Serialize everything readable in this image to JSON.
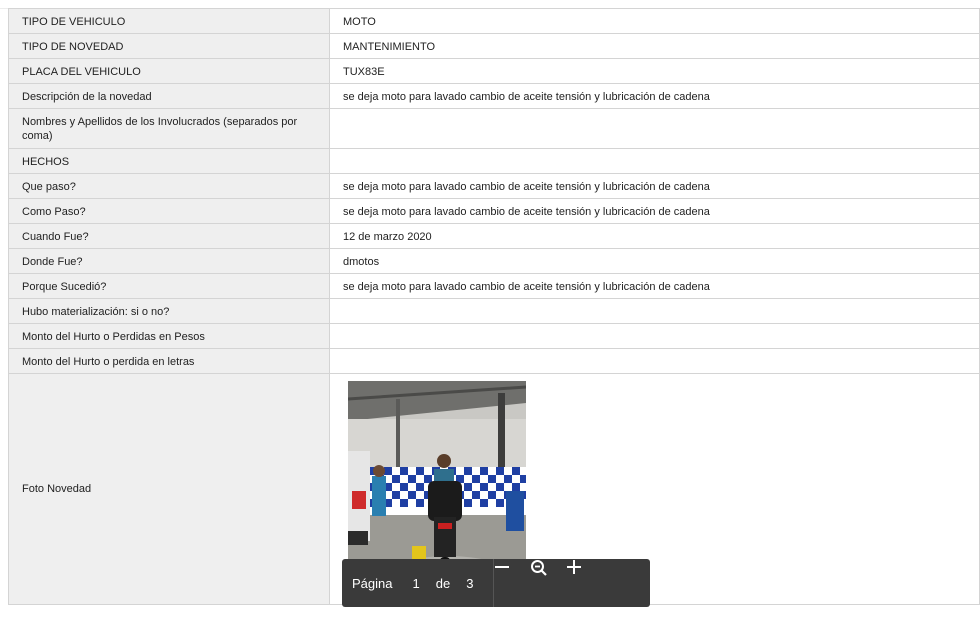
{
  "rows": [
    {
      "label": "TIPO DE VEHICULO",
      "value": "MOTO"
    },
    {
      "label": "TIPO DE NOVEDAD",
      "value": "MANTENIMIENTO"
    },
    {
      "label": "PLACA DEL VEHICULO",
      "value": "TUX83E"
    },
    {
      "label": "Descripción de la novedad",
      "value": "se deja moto para lavado cambio de aceite tensión y lubricación de cadena"
    },
    {
      "label": "Nombres y Apellidos de los Involucrados (separados por coma)",
      "value": ""
    },
    {
      "label": "HECHOS",
      "value": ""
    },
    {
      "label": "Que paso?",
      "value": "se deja moto para lavado cambio de aceite tensión y lubricación de cadena"
    },
    {
      "label": "Como Paso?",
      "value": "se deja moto para lavado cambio de aceite tensión y lubricación de cadena"
    },
    {
      "label": "Cuando Fue?",
      "value": "12 de marzo 2020"
    },
    {
      "label": "Donde Fue?",
      "value": "dmotos"
    },
    {
      "label": "Porque Sucedió?",
      "value": "se deja moto para lavado cambio de aceite tensión y lubricación de cadena"
    },
    {
      "label": "Hubo materialización: si o no?",
      "value": ""
    },
    {
      "label": "Monto del Hurto o Perdidas en Pesos",
      "value": ""
    },
    {
      "label": "Monto del Hurto o perdida en letras",
      "value": ""
    },
    {
      "label": "Foto Novedad",
      "value": ""
    }
  ],
  "pager": {
    "label": "Página",
    "current": "1",
    "of": "de",
    "total": "3",
    "icons": [
      "minus-icon",
      "zoom-out-icon",
      "plus-icon"
    ]
  },
  "colors": {
    "label_bg": "#efefef",
    "border": "#d4d4d4",
    "pager_bg": "#3a3a3a"
  }
}
